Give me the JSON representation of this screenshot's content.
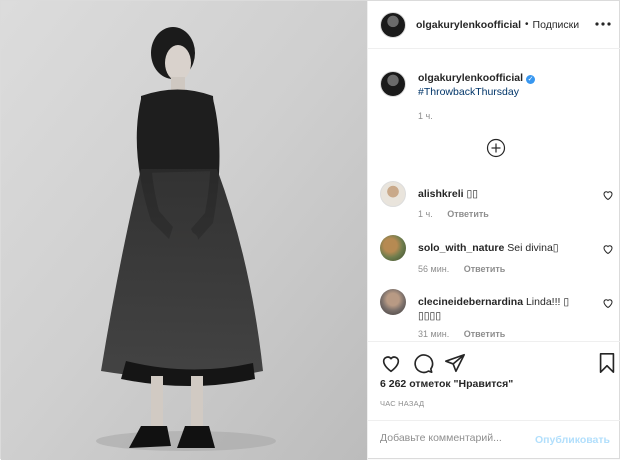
{
  "header": {
    "username": "olgakurylenkoofficial",
    "separator": "•",
    "follow_label": "Подписки"
  },
  "photo": {
    "description_icon": "photo-icon"
  },
  "caption": {
    "username": "olgakurylenkoofficial",
    "hashtag": "#ThrowbackThursday",
    "time": "1 ч."
  },
  "comments": [
    {
      "username": "alishkreli",
      "text": "▯▯",
      "time": "1 ч.",
      "reply": "Ответить"
    },
    {
      "username": "solo_with_nature",
      "text": "Sei divina▯",
      "time": "56 мин.",
      "reply": "Ответить"
    },
    {
      "username": "clecineidebernardina",
      "text": "Linda!!! ▯ ▯▯▯▯",
      "time": "31 мин.",
      "reply": "Ответить"
    }
  ],
  "likes": "6 262 отметок \"Нравится\"",
  "ago": "ЧАС НАЗАД",
  "add_comment": {
    "placeholder": "Добавьте комментарий...",
    "publish_label": "Опубликовать"
  },
  "colors": {
    "accent": "#3897f0",
    "publish_disabled": "#b2dffc",
    "muted": "#8e8e8e"
  }
}
